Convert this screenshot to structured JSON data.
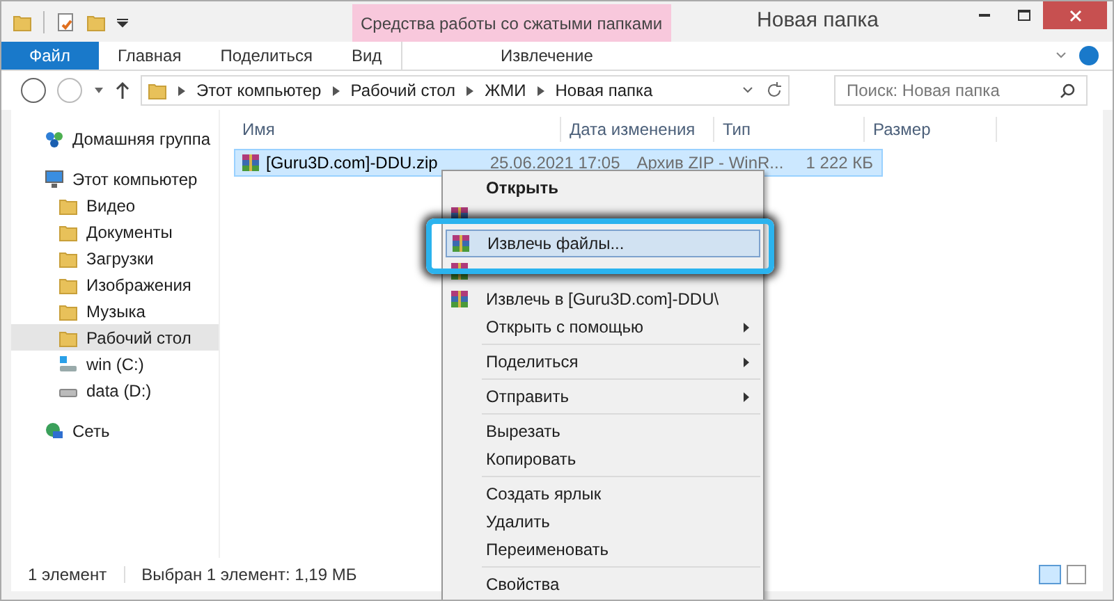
{
  "title_bar": {
    "tool_group": "Средства работы со сжатыми папками",
    "title": "Новая папка"
  },
  "ribbon_tabs": [
    {
      "label": "Файл",
      "kind": "file"
    },
    {
      "label": "Главная",
      "kind": "normal"
    },
    {
      "label": "Поделиться",
      "kind": "normal"
    },
    {
      "label": "Вид",
      "kind": "normal"
    },
    {
      "label": "Извлечение",
      "kind": "contextual"
    }
  ],
  "address_bar": {
    "path": [
      "Этот компьютер",
      "Рабочий стол",
      "ЖМИ",
      "Новая папка"
    ]
  },
  "search": {
    "placeholder": "Поиск: Новая папка"
  },
  "sidebar": {
    "items": [
      {
        "label": "Домашняя группа",
        "kind": "homegroup",
        "selected": false
      },
      {
        "label": "Этот компьютер",
        "kind": "computer",
        "selected": false,
        "children": [
          {
            "label": "Видео",
            "kind": "folder",
            "selected": false
          },
          {
            "label": "Документы",
            "kind": "folder",
            "selected": false
          },
          {
            "label": "Загрузки",
            "kind": "folder",
            "selected": false
          },
          {
            "label": "Изображения",
            "kind": "folder",
            "selected": false
          },
          {
            "label": "Музыка",
            "kind": "folder",
            "selected": false
          },
          {
            "label": "Рабочий стол",
            "kind": "folder",
            "selected": true
          },
          {
            "label": "win (C:)",
            "kind": "system-drive",
            "selected": false
          },
          {
            "label": "data (D:)",
            "kind": "drive",
            "selected": false
          }
        ]
      },
      {
        "label": "Сеть",
        "kind": "network",
        "selected": false
      }
    ]
  },
  "table": {
    "columns": [
      "Имя",
      "Дата изменения",
      "Тип",
      "Размер"
    ],
    "rows": [
      {
        "name": "[Guru3D.com]-DDU.zip",
        "date": "25.06.2021 17:05",
        "type": "Архив ZIP - WinR...",
        "size": "1 222 КБ",
        "selected": true
      }
    ]
  },
  "context_menu": {
    "items": [
      {
        "kind": "item",
        "label": "Открыть",
        "bold": true,
        "icon": false,
        "submenu": false,
        "selected": false
      },
      {
        "kind": "covered",
        "icon": true
      },
      {
        "kind": "item",
        "label": "Извлечь файлы...",
        "bold": false,
        "icon": true,
        "submenu": false,
        "selected": true
      },
      {
        "kind": "covered",
        "icon": true
      },
      {
        "kind": "item",
        "label": "Извлечь в [Guru3D.com]-DDU\\",
        "bold": false,
        "icon": true,
        "submenu": false,
        "selected": false
      },
      {
        "kind": "item",
        "label": "Открыть с помощью",
        "bold": false,
        "icon": false,
        "submenu": true,
        "selected": false
      },
      {
        "kind": "separator"
      },
      {
        "kind": "item",
        "label": "Поделиться",
        "bold": false,
        "icon": false,
        "submenu": true,
        "selected": false
      },
      {
        "kind": "separator"
      },
      {
        "kind": "item",
        "label": "Отправить",
        "bold": false,
        "icon": false,
        "submenu": true,
        "selected": false
      },
      {
        "kind": "separator"
      },
      {
        "kind": "item",
        "label": "Вырезать",
        "bold": false,
        "icon": false,
        "submenu": false,
        "selected": false
      },
      {
        "kind": "item",
        "label": "Копировать",
        "bold": false,
        "icon": false,
        "submenu": false,
        "selected": false
      },
      {
        "kind": "separator"
      },
      {
        "kind": "item",
        "label": "Создать ярлык",
        "bold": false,
        "icon": false,
        "submenu": false,
        "selected": false
      },
      {
        "kind": "item",
        "label": "Удалить",
        "bold": false,
        "icon": false,
        "submenu": false,
        "selected": false
      },
      {
        "kind": "item",
        "label": "Переименовать",
        "bold": false,
        "icon": false,
        "submenu": false,
        "selected": false
      },
      {
        "kind": "separator"
      },
      {
        "kind": "item",
        "label": "Свойства",
        "bold": false,
        "icon": false,
        "submenu": false,
        "selected": false
      }
    ]
  },
  "status_bar": {
    "count": "1 элемент",
    "selection": "Выбран 1 элемент: 1,19 МБ"
  }
}
